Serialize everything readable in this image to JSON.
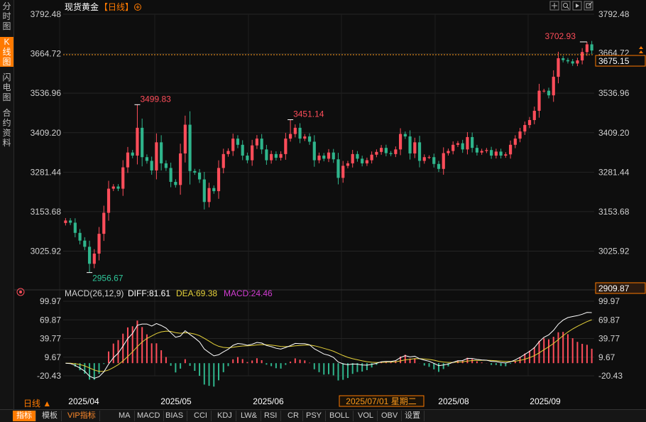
{
  "side_tabs": [
    {
      "label": "分\n时\n图",
      "active": false
    },
    {
      "label": "K\n线\n图",
      "active": true
    },
    {
      "label": "闪\n电\n图",
      "active": false
    },
    {
      "label": "合\n约\n资\n料",
      "active": false
    }
  ],
  "title": "现货黄金",
  "period_tag": "【日线】",
  "add_icon": "circle-plus-icon",
  "toolbar_icons": [
    "crosshair-icon",
    "zoom-in-icon",
    "play-icon",
    "export-icon"
  ],
  "price_axis": [
    "3792.48",
    "3664.72",
    "3536.96",
    "3409.20",
    "3281.44",
    "3153.68",
    "3025.92"
  ],
  "current_price": "3675.15",
  "hidden_price": "3664.72",
  "axis_min_label": "2909.87",
  "annotations": {
    "high_may": "3499.83",
    "high_jun": "3451.14",
    "low_apr": "2956.67",
    "high_sep": "3702.93"
  },
  "macd": {
    "label": "MACD(26,12,9)",
    "diff": "DIFF:81.61",
    "dea": "DEA:69.38",
    "macd": "MACD:24.46",
    "axis": [
      "99.97",
      "69.87",
      "39.77",
      "9.67",
      "-20.43"
    ]
  },
  "period_label": "日线 ▲",
  "date_labels": [
    "2025/04",
    "2025/05",
    "2025/06",
    "2025/08",
    "2025/09"
  ],
  "cursor_date": "2025/07/01 星期二",
  "bottom_tabs": [
    "指标",
    "模板",
    "VIP指标",
    "MA",
    "MACD",
    "BIAS",
    "CCI",
    "KDJ",
    "LW&",
    "RSI",
    "CR",
    "PSY",
    "BOLL",
    "VOL",
    "OBV",
    "设置"
  ],
  "colors": {
    "up": "#ff4d5a",
    "down": "#2fb58c",
    "diff": "#ffffff",
    "dea": "#e6d23a",
    "macd": "#d23cd2",
    "accent": "#ff7a00"
  },
  "chart_data": {
    "type": "candlestick",
    "title": "现货黄金",
    "ylim": [
      2909.87,
      3792.48
    ],
    "closes": [
      3125,
      3118,
      3085,
      3060,
      3040,
      2985,
      3018,
      3082,
      3150,
      3228,
      3235,
      3228,
      3297,
      3345,
      3335,
      3425,
      3330,
      3318,
      3287,
      3378,
      3310,
      3295,
      3250,
      3240,
      3342,
      3435,
      3285,
      3280,
      3258,
      3185,
      3230,
      3220,
      3295,
      3340,
      3350,
      3390,
      3370,
      3335,
      3320,
      3368,
      3390,
      3355,
      3320,
      3340,
      3328,
      3340,
      3390,
      3405,
      3425,
      3390,
      3397,
      3380,
      3320,
      3335,
      3325,
      3345,
      3323,
      3263,
      3302,
      3310,
      3340,
      3325,
      3310,
      3320,
      3338,
      3347,
      3360,
      3343,
      3340,
      3355,
      3405,
      3397,
      3342,
      3378,
      3318,
      3330,
      3330,
      3308,
      3292,
      3343,
      3350,
      3370,
      3375,
      3355,
      3395,
      3360,
      3345,
      3350,
      3353,
      3335,
      3348,
      3335,
      3339,
      3370,
      3390,
      3413,
      3434,
      3450,
      3480,
      3545,
      3545,
      3530,
      3590,
      3650,
      3644,
      3640,
      3633,
      3643,
      3670,
      3695,
      3675
    ],
    "high": 3702.93,
    "low": 2956.67
  }
}
